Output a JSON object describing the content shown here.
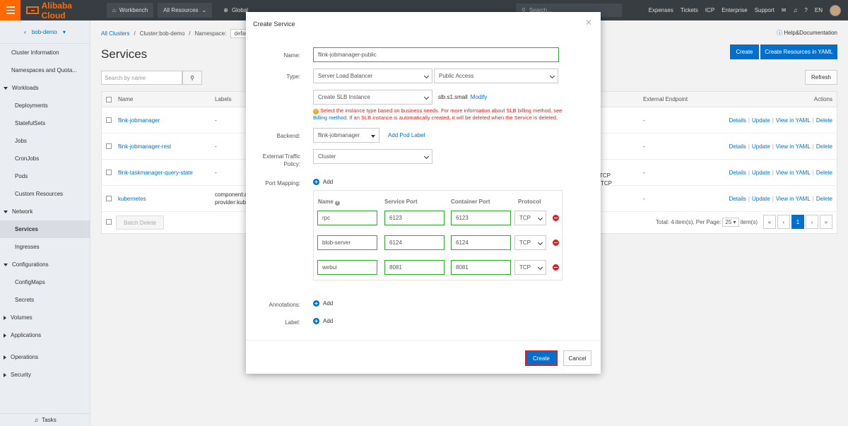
{
  "topbar": {
    "logo_text": "Alibaba Cloud",
    "workbench": "Workbench",
    "all_resources": "All Resources",
    "global": "Global",
    "search_placeholder": "Search...",
    "links": [
      "Expenses",
      "Tickets",
      "ICP",
      "Enterprise",
      "Support"
    ],
    "lang": "EN"
  },
  "sidebar": {
    "cluster_name": "bob-demo",
    "items": {
      "cluster_info": "Cluster Information",
      "namespaces": "Namespaces and Quota...",
      "workloads": "Workloads",
      "deployments": "Deployments",
      "statefulsets": "StatefulSets",
      "jobs": "Jobs",
      "cronjobs": "CronJobs",
      "pods": "Pods",
      "custom_resources": "Custom Resources",
      "network": "Network",
      "services": "Services",
      "ingresses": "Ingresses",
      "configurations": "Configurations",
      "configmaps": "ConfigMaps",
      "secrets": "Secrets",
      "volumes": "Volumes",
      "applications": "Applications",
      "operations": "Operations",
      "security": "Security"
    },
    "tasks": "Tasks"
  },
  "main": {
    "breadcrumb": {
      "all_clusters": "All Clusters",
      "cluster": "Cluster:bob-demo",
      "namespace_label": "Namespace:",
      "namespace_value": "default"
    },
    "help": "Help&Documentation",
    "title": "Services",
    "create_btn": "Create",
    "create_yaml_btn": "Create Resources in YAML",
    "search_placeholder": "Search by name",
    "refresh_btn": "Refresh",
    "table": {
      "headers": {
        "name": "Name",
        "labels": "Labels",
        "external": "External Endpoint",
        "actions": "Actions"
      },
      "rows": [
        {
          "name": "flink-jobmanager",
          "labels": "-",
          "labels2": "",
          "ext": "-"
        },
        {
          "name": "flink-jobmanager-rest",
          "labels": "-",
          "labels2": "",
          "ext": "-"
        },
        {
          "name": "flink-taskmanager-query-state",
          "labels": "-",
          "labels2": "",
          "ext": "-"
        },
        {
          "name": "kubernetes",
          "labels": "component:a",
          "labels2": "provider:kube",
          "ext": "-"
        }
      ],
      "peek_tcp": [
        "TCP",
        "TCP"
      ],
      "actions": [
        "Details",
        "Update",
        "View in YAML",
        "Delete"
      ],
      "batch_delete": "Batch Delete",
      "total": "Total: 4 item(s), Per Page:",
      "per_page": "25",
      "items_suffix": "item(s)",
      "current_page": "1"
    }
  },
  "modal": {
    "title": "Create Service",
    "name_label": "Name:",
    "name_value": "flink-jobmanager-public",
    "type_label": "Type:",
    "type_value": "Server Load Balancer",
    "access_value": "Public Access",
    "slb_value": "Create SLB Instance",
    "slb_spec": "slb.s1.small",
    "modify": "Modify",
    "warning_text": "Select the instance type based on business needs. For more information about SLB billing method, see",
    "warning_link": "Billing method",
    "warning_text2": ". If an SLB instance is automatically created, it will be deleted when the Service is deleted.",
    "backend_label": "Backend:",
    "backend_value": "flink-jobmanager",
    "add_pod_label": "Add Pod Label",
    "etp_label_1": "External Traffic",
    "etp_label_2": "Policy:",
    "etp_value": "Cluster",
    "port_mapping_label": "Port Mapping:",
    "add": "Add",
    "port_headers": {
      "name": "Name",
      "service_port": "Service Port",
      "container_port": "Container Port",
      "protocol": "Protocol"
    },
    "ports": [
      {
        "name": "rpc",
        "service_port": "6123",
        "container_port": "6123",
        "protocol": "TCP"
      },
      {
        "name": "blob-server",
        "service_port": "6124",
        "container_port": "6124",
        "protocol": "TCP"
      },
      {
        "name": "webui",
        "service_port": "8081",
        "container_port": "8081",
        "protocol": "TCP"
      }
    ],
    "annotations_label": "Annotations:",
    "label_label": "Label:",
    "create_btn": "Create",
    "cancel_btn": "Cancel"
  }
}
